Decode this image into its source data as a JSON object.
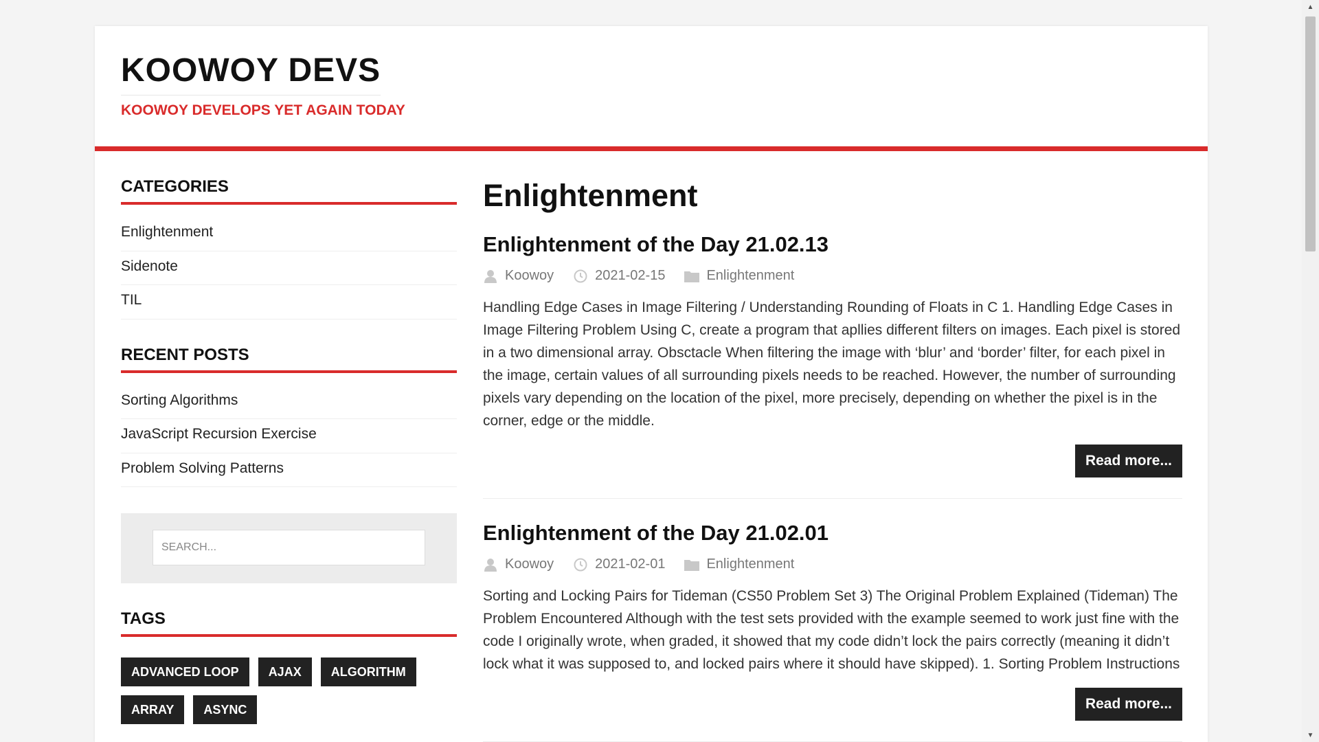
{
  "site": {
    "title": "KOOWOY DEVS",
    "description": "KOOWOY DEVELOPS YET AGAIN TODAY",
    "accent_color": "#d92b2b"
  },
  "sidebar": {
    "categories_title": "CATEGORIES",
    "categories": [
      "Enlightenment",
      "Sidenote",
      "TIL"
    ],
    "recent_title": "RECENT POSTS",
    "recent_posts": [
      "Sorting Algorithms",
      "JavaScript Recursion Exercise",
      "Problem Solving Patterns"
    ],
    "search_placeholder": "SEARCH...",
    "tags_title": "TAGS",
    "tags": [
      "ADVANCED LOOP",
      "AJAX",
      "ALGORITHM",
      "ARRAY",
      "ASYNC"
    ]
  },
  "main": {
    "archive_title": "Enlightenment",
    "posts": [
      {
        "title": "Enlightenment of the Day 21.02.13",
        "author": "Koowoy",
        "date": "2021-02-15",
        "category": "Enlightenment",
        "excerpt": "Handling Edge Cases in Image Filtering / Understanding Rounding of Floats in C 1. Handling Edge Cases in Image Filtering Problem Using C, create a program that apllies different filters on images. Each pixel is stored in a two dimensional array. Obsctacle When filtering the image with ‘blur’ and ‘border’ filter, for each pixel in the image, certain values of all surrounding pixels needs to be reached. However, the number of surrounding pixels vary depending on the location of the pixel, more precisely, depending on whether the pixel is in the corner, edge or the middle.",
        "read_more": "Read more..."
      },
      {
        "title": "Enlightenment of the Day 21.02.01",
        "author": "Koowoy",
        "date": "2021-02-01",
        "category": "Enlightenment",
        "excerpt": "Sorting and Locking Pairs for Tideman (CS50 Problem Set 3) The Original Problem Explained (Tideman) The Problem Encountered Although with the test sets provided with the example seemed to work just fine with the code I originally wrote, when graded, it showed that my code didn’t lock the pairs correctly (meaning it didn’t lock what it was supposed to, and locked pairs where it should have skipped). 1. Sorting Problem Instructions",
        "read_more": "Read more..."
      }
    ]
  },
  "icons": {
    "author": "user-icon",
    "date": "clock-icon",
    "category": "folder-icon"
  }
}
